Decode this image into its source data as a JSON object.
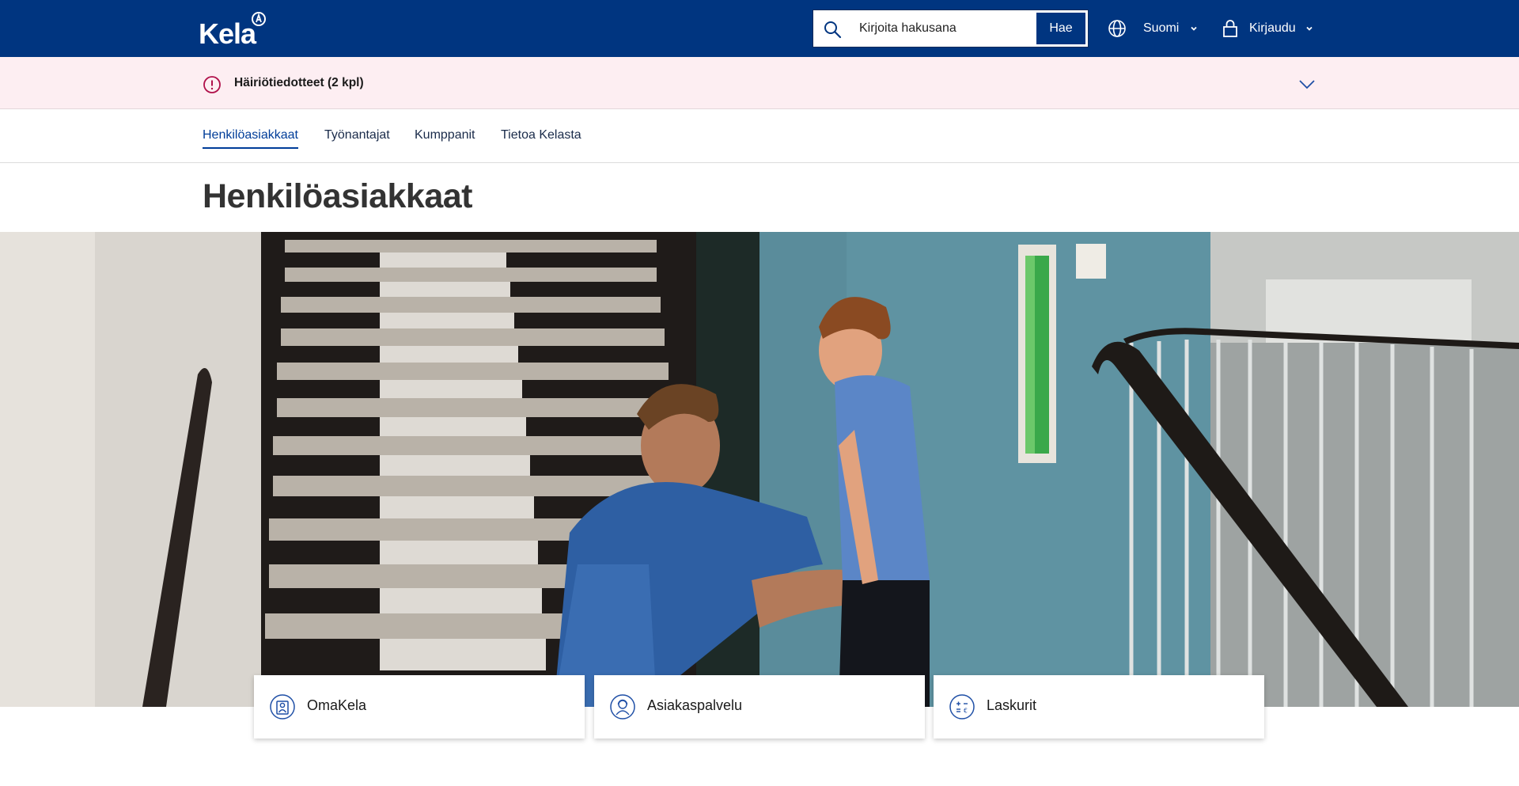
{
  "header": {
    "logo_text": "Kela",
    "search": {
      "placeholder": "Kirjoita hakusana",
      "button_label": "Hae"
    },
    "language": {
      "label": "Suomi"
    },
    "login": {
      "label": "Kirjaudu"
    }
  },
  "alert": {
    "text": "Häiriötiedotteet (2 kpl)"
  },
  "nav": {
    "items": [
      {
        "label": "Henkilöasiakkaat",
        "active": true
      },
      {
        "label": "Työnantajat",
        "active": false
      },
      {
        "label": "Kumppanit",
        "active": false
      },
      {
        "label": "Tietoa Kelasta",
        "active": false
      }
    ]
  },
  "page": {
    "title": "Henkilöasiakkaat"
  },
  "cards": [
    {
      "label": "OmaKela",
      "icon": "omakela-icon"
    },
    {
      "label": "Asiakaspalvelu",
      "icon": "customer-service-icon"
    },
    {
      "label": "Laskurit",
      "icon": "calculator-icon"
    }
  ],
  "colors": {
    "brand_blue": "#003580",
    "alert_background": "#fdeef2",
    "alert_accent": "#b0104a",
    "nav_active": "#003d99"
  }
}
